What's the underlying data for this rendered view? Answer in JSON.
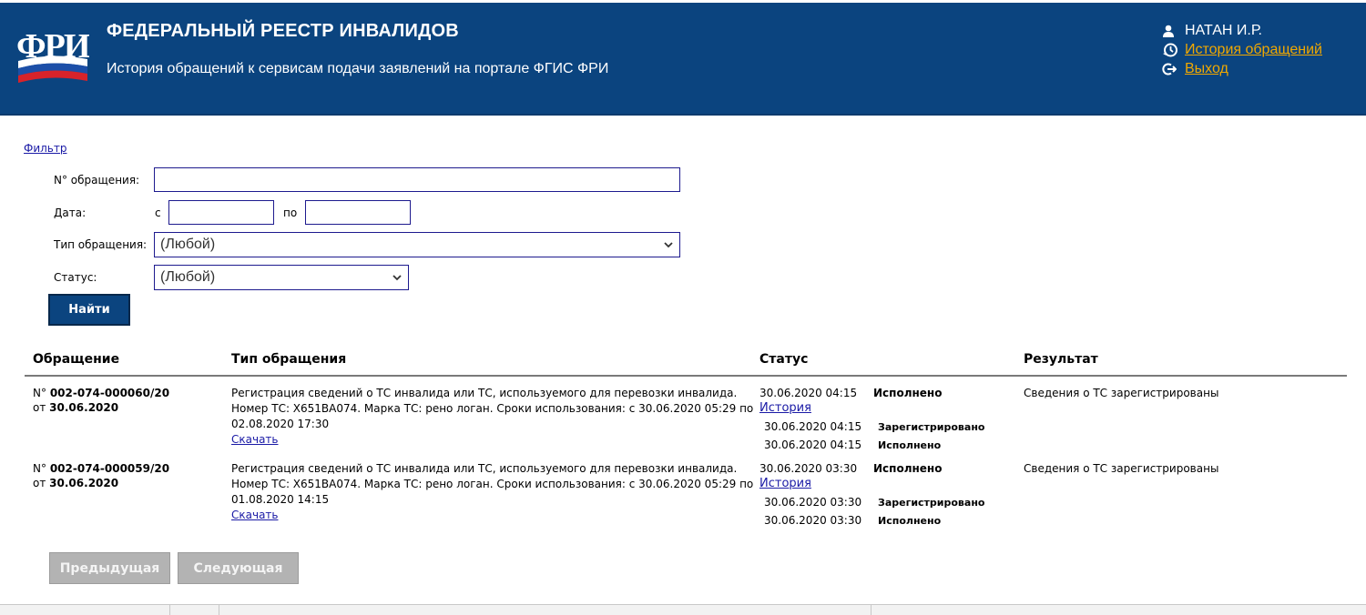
{
  "header": {
    "title": "ФЕДЕРАЛЬНЫЙ РЕЕСТР ИНВАЛИДОВ",
    "subtitle": "История обращений к сервисам подачи заявлений на портале ФГИС ФРИ",
    "logo_text": "ФРИ",
    "colors": {
      "background": "#0b447f",
      "link": "#f0a800"
    },
    "user": {
      "name": "НАТАН И.Р.",
      "history_link": "История обращений",
      "logout_link": "Выход"
    }
  },
  "filter": {
    "toggle_label": "Фильтр",
    "number_label": "N° обращения:",
    "number_value": "",
    "date_label": "Дата:",
    "date_from_label": "с",
    "date_to_label": "по",
    "date_from_value": "",
    "date_to_value": "",
    "type_label": "Тип обращения:",
    "type_value": "(Любой)",
    "status_label": "Статус:",
    "status_value": "(Любой)",
    "find_button": "Найти"
  },
  "table": {
    "headers": [
      "Обращение",
      "Тип обращения",
      "Статус",
      "Результат"
    ],
    "rows": [
      {
        "number_prefix": "N°",
        "number": "002-074-000060/20",
        "date_prefix": "от",
        "date": "30.06.2020",
        "type_text": "Регистрация сведений о ТС инвалида или ТС, используемого для перевозки инвалида. Номер ТС: Х651ВА074. Марка ТС: рено логан. Сроки использования: с 30.06.2020 05:29 по 02.08.2020 17:30",
        "download_link": "Скачать",
        "status_datetime": "30.06.2020 04:15",
        "status_value": "Исполнено",
        "history_link": "История",
        "history": [
          {
            "datetime": "30.06.2020 04:15",
            "status": "Зарегистрировано"
          },
          {
            "datetime": "30.06.2020 04:15",
            "status": "Исполнено"
          }
        ],
        "result": "Сведения о ТС зарегистрированы"
      },
      {
        "number_prefix": "N°",
        "number": "002-074-000059/20",
        "date_prefix": "от",
        "date": "30.06.2020",
        "type_text": "Регистрация сведений о ТС инвалида или ТС, используемого для перевозки инвалида. Номер ТС: Х651ВА074. Марка ТС: рено логан. Сроки использования: с 30.06.2020 05:29 по 01.08.2020 14:15",
        "download_link": "Скачать",
        "status_datetime": "30.06.2020 03:30",
        "status_value": "Исполнено",
        "history_link": "История",
        "history": [
          {
            "datetime": "30.06.2020 03:30",
            "status": "Зарегистрировано"
          },
          {
            "datetime": "30.06.2020 03:30",
            "status": "Исполнено"
          }
        ],
        "result": "Сведения о ТС зарегистрированы"
      }
    ]
  },
  "pagination": {
    "prev_label": "Предыдущая",
    "next_label": "Следующая"
  },
  "icons": [
    "user-icon",
    "history-icon",
    "logout-icon",
    "chevron-down-icon"
  ]
}
